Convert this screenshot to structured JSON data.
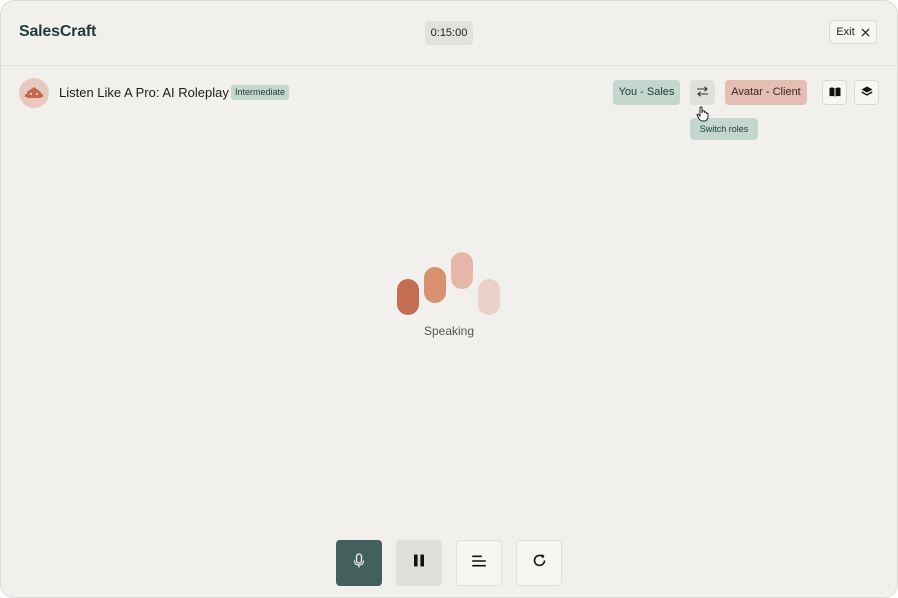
{
  "header": {
    "logo": "SalesCraft",
    "timer": "0:15:00",
    "exit_label": "Exit"
  },
  "session": {
    "title": "Listen Like A Pro: AI Roleplay",
    "level_badge": "Intermediate",
    "role_you": "You - Sales",
    "role_avatar": "Avatar - Client",
    "switch_tooltip": "Switch roles"
  },
  "status": {
    "label": "Speaking"
  },
  "colors": {
    "brand": "#1f3b3b",
    "sales_role": "#c3d7cf",
    "client_role": "#e6bdb2",
    "mic_active": "#44605d",
    "wave_1": "#c46d51",
    "wave_2": "#d8906f",
    "wave_3": "#e6b7a8",
    "wave_4": "#ecd1c8"
  },
  "icons": {
    "exit": "close-icon",
    "avatar": "robot-icon",
    "switch": "swap-arrows-icon",
    "guide": "book-icon",
    "layers": "layers-icon",
    "mic": "microphone-icon",
    "pause": "pause-icon",
    "transcript": "align-left-icon",
    "restart": "refresh-icon"
  }
}
